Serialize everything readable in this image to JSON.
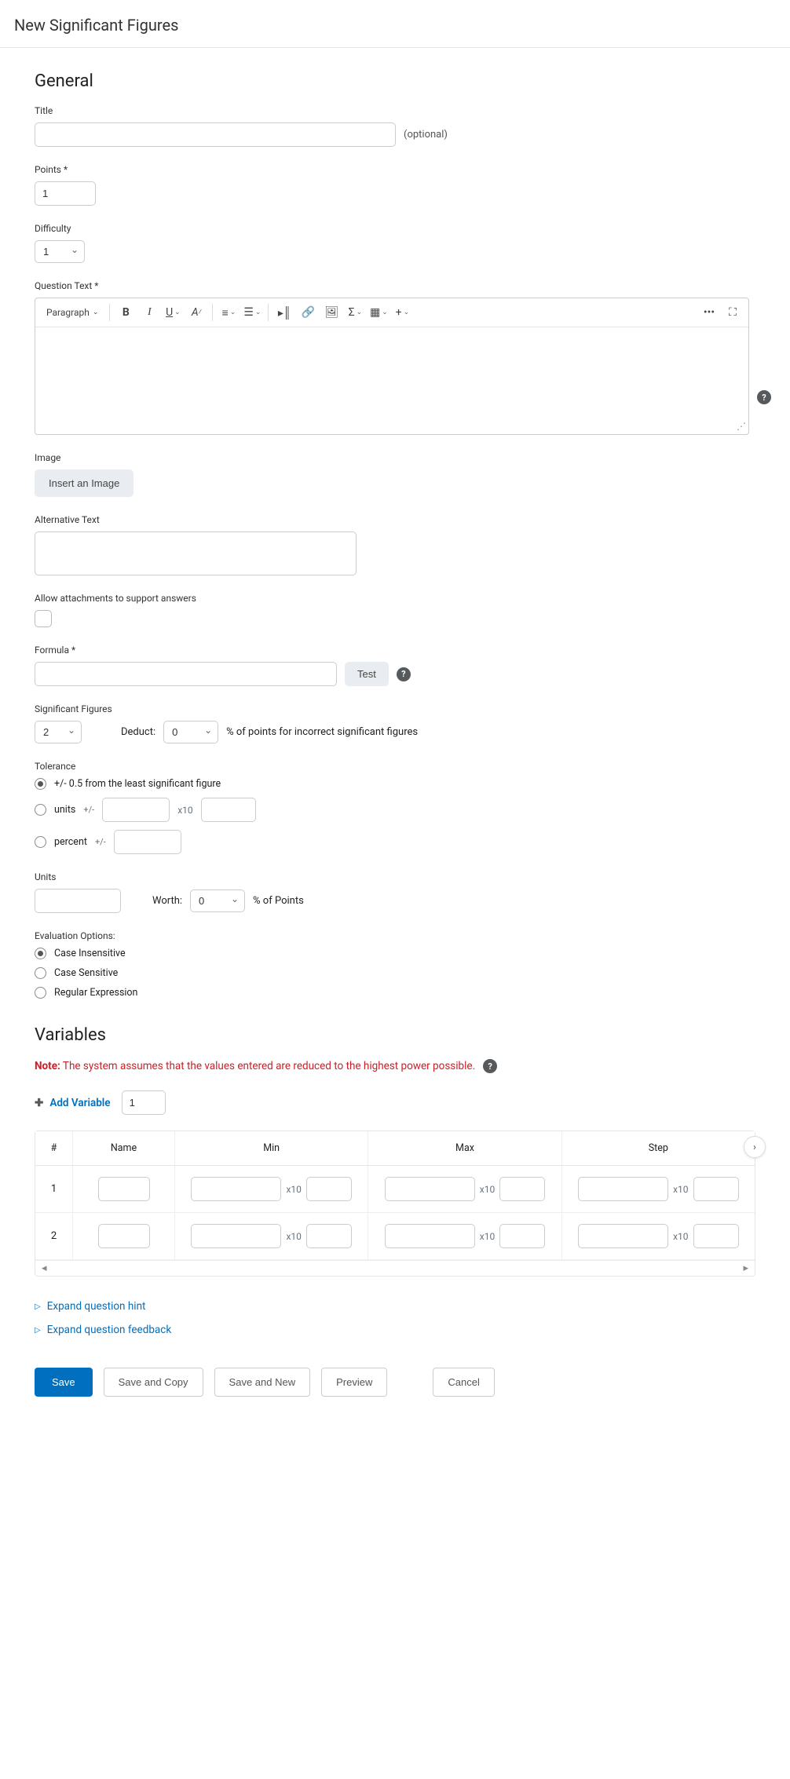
{
  "header": {
    "title": "New Significant Figures"
  },
  "general": {
    "heading": "General",
    "title_label": "Title",
    "title_value": "",
    "optional": "(optional)",
    "points_label": "Points",
    "points_value": "1",
    "difficulty_label": "Difficulty",
    "difficulty_value": "1",
    "question_text_label": "Question Text",
    "rte": {
      "format": "Paragraph",
      "bold": "B",
      "italic": "I",
      "underline": "U",
      "more": "•••"
    },
    "image_label": "Image",
    "insert_image": "Insert an Image",
    "alt_text_label": "Alternative Text",
    "alt_text_value": "",
    "allow_attach_label": "Allow attachments to support answers",
    "formula_label": "Formula",
    "formula_value": "",
    "test": "Test",
    "sigfig_label": "Significant Figures",
    "sigfig_value": "2",
    "deduct_label": "Deduct:",
    "deduct_value": "0",
    "deduct_suffix": "% of points for incorrect significant figures",
    "tolerance_label": "Tolerance",
    "tol_opt1": "+/- 0.5 from the least significant figure",
    "tol_opt2_prefix": "units",
    "tol_opt3_prefix": "percent",
    "pm": "+/-",
    "x10": "x10",
    "units_label": "Units",
    "units_value": "",
    "worth_label": "Worth:",
    "worth_value": "0",
    "worth_suffix": "% of Points",
    "eval_label": "Evaluation Options:",
    "eval_opt1": "Case Insensitive",
    "eval_opt2": "Case Sensitive",
    "eval_opt3": "Regular Expression"
  },
  "variables": {
    "heading": "Variables",
    "note_prefix": "Note:",
    "note_text": "The system assumes that the values entered are reduced to the highest power possible.",
    "add_variable": "Add Variable",
    "count": "1",
    "cols": {
      "num": "#",
      "name": "Name",
      "min": "Min",
      "max": "Max",
      "step": "Step"
    },
    "rows": [
      {
        "num": "1"
      },
      {
        "num": "2"
      }
    ],
    "x10": "x10"
  },
  "expand": {
    "hint": "Expand question hint",
    "feedback": "Expand question feedback"
  },
  "footer": {
    "save": "Save",
    "save_copy": "Save and Copy",
    "save_new": "Save and New",
    "preview": "Preview",
    "cancel": "Cancel"
  },
  "help": "?"
}
